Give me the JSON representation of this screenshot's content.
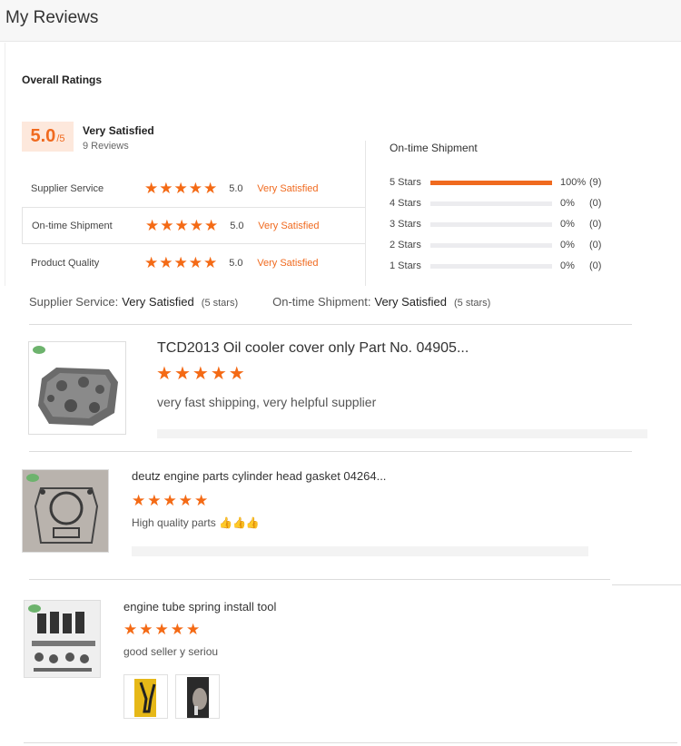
{
  "header": {
    "title": "My Reviews"
  },
  "summary": {
    "section_title": "Overall Ratings",
    "score": "5.0",
    "score_max": "/5",
    "overall_label": "Very Satisfied",
    "review_count": "9 Reviews",
    "categories": [
      {
        "name": "Supplier Service",
        "score": "5.0",
        "label": "Very Satisfied",
        "stars": 5
      },
      {
        "name": "On-time Shipment",
        "score": "5.0",
        "label": "Very Satisfied",
        "stars": 5
      },
      {
        "name": "Product Quality",
        "score": "5.0",
        "label": "Very Satisfied",
        "stars": 5
      }
    ],
    "distribution": {
      "title": "On-time Shipment",
      "rows": [
        {
          "label": "5 Stars",
          "pct": "100%",
          "count": "(9)",
          "fraction": 1.0
        },
        {
          "label": "4 Stars",
          "pct": "0%",
          "count": "(0)",
          "fraction": 0
        },
        {
          "label": "3 Stars",
          "pct": "0%",
          "count": "(0)",
          "fraction": 0
        },
        {
          "label": "2 Stars",
          "pct": "0%",
          "count": "(0)",
          "fraction": 0
        },
        {
          "label": "1 Stars",
          "pct": "0%",
          "count": "(0)",
          "fraction": 0
        }
      ]
    }
  },
  "subline": {
    "service_label": "Supplier Service:",
    "service_value": "Very Satisfied",
    "service_stars": "(5 stars)",
    "shipment_label": "On-time Shipment:",
    "shipment_value": "Very Satisfied",
    "shipment_stars": "(5 stars)"
  },
  "reviews": [
    {
      "title": "TCD2013 Oil cooler cover only Part No. 04905...",
      "stars": 5,
      "text": "very fast shipping, very helpful supplier"
    },
    {
      "title": "deutz engine parts cylinder head gasket 04264...",
      "stars": 5,
      "text": "High quality parts 👍👍👍"
    },
    {
      "title": "engine tube spring install tool",
      "stars": 5,
      "text": "good seller y seriou"
    }
  ],
  "icons": {
    "star": "star-icon",
    "logo": "supplier-logo-icon"
  },
  "colors": {
    "accent": "#f06a1f",
    "star": "#f46a15",
    "score_bg": "#fde8dc"
  }
}
